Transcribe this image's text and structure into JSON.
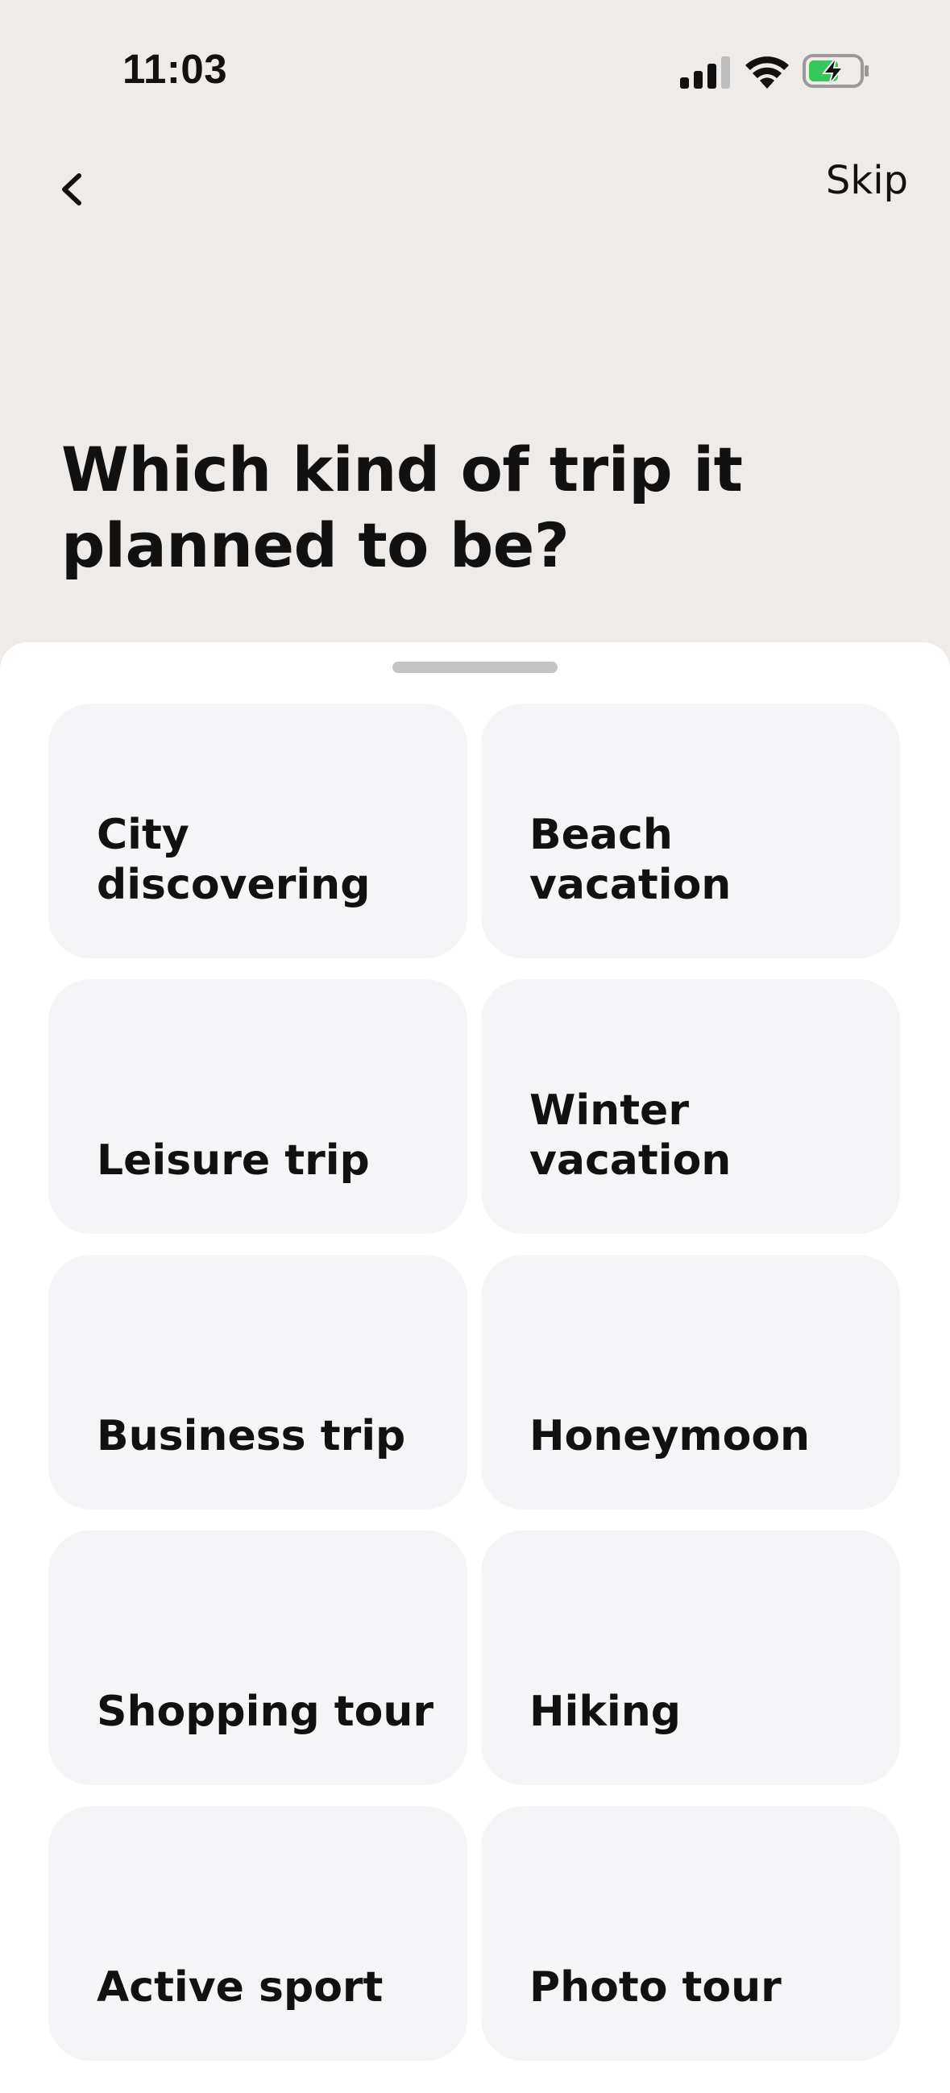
{
  "status_bar": {
    "time": "11:03",
    "icons": [
      "cellular-signal-icon",
      "wifi-icon",
      "battery-charging-icon"
    ],
    "battery_color": "#34C759"
  },
  "nav": {
    "back_icon": "chevron-left-icon",
    "skip_label": "Skip"
  },
  "question": {
    "title": "Which kind of trip it planned to be?"
  },
  "options": [
    {
      "label": "City\ndiscovering"
    },
    {
      "label": "Beach\nvacation"
    },
    {
      "label": "Leisure trip"
    },
    {
      "label": "Winter\nvacation"
    },
    {
      "label": "Business trip"
    },
    {
      "label": "Honeymoon"
    },
    {
      "label": "Shopping tour"
    },
    {
      "label": "Hiking"
    },
    {
      "label": "Active sport"
    },
    {
      "label": "Photo tour"
    }
  ],
  "colors": {
    "header_background": "#EFEBE8",
    "sheet_background": "#FFFFFF",
    "card_background": "#F5F5F7",
    "text": "#111111"
  }
}
